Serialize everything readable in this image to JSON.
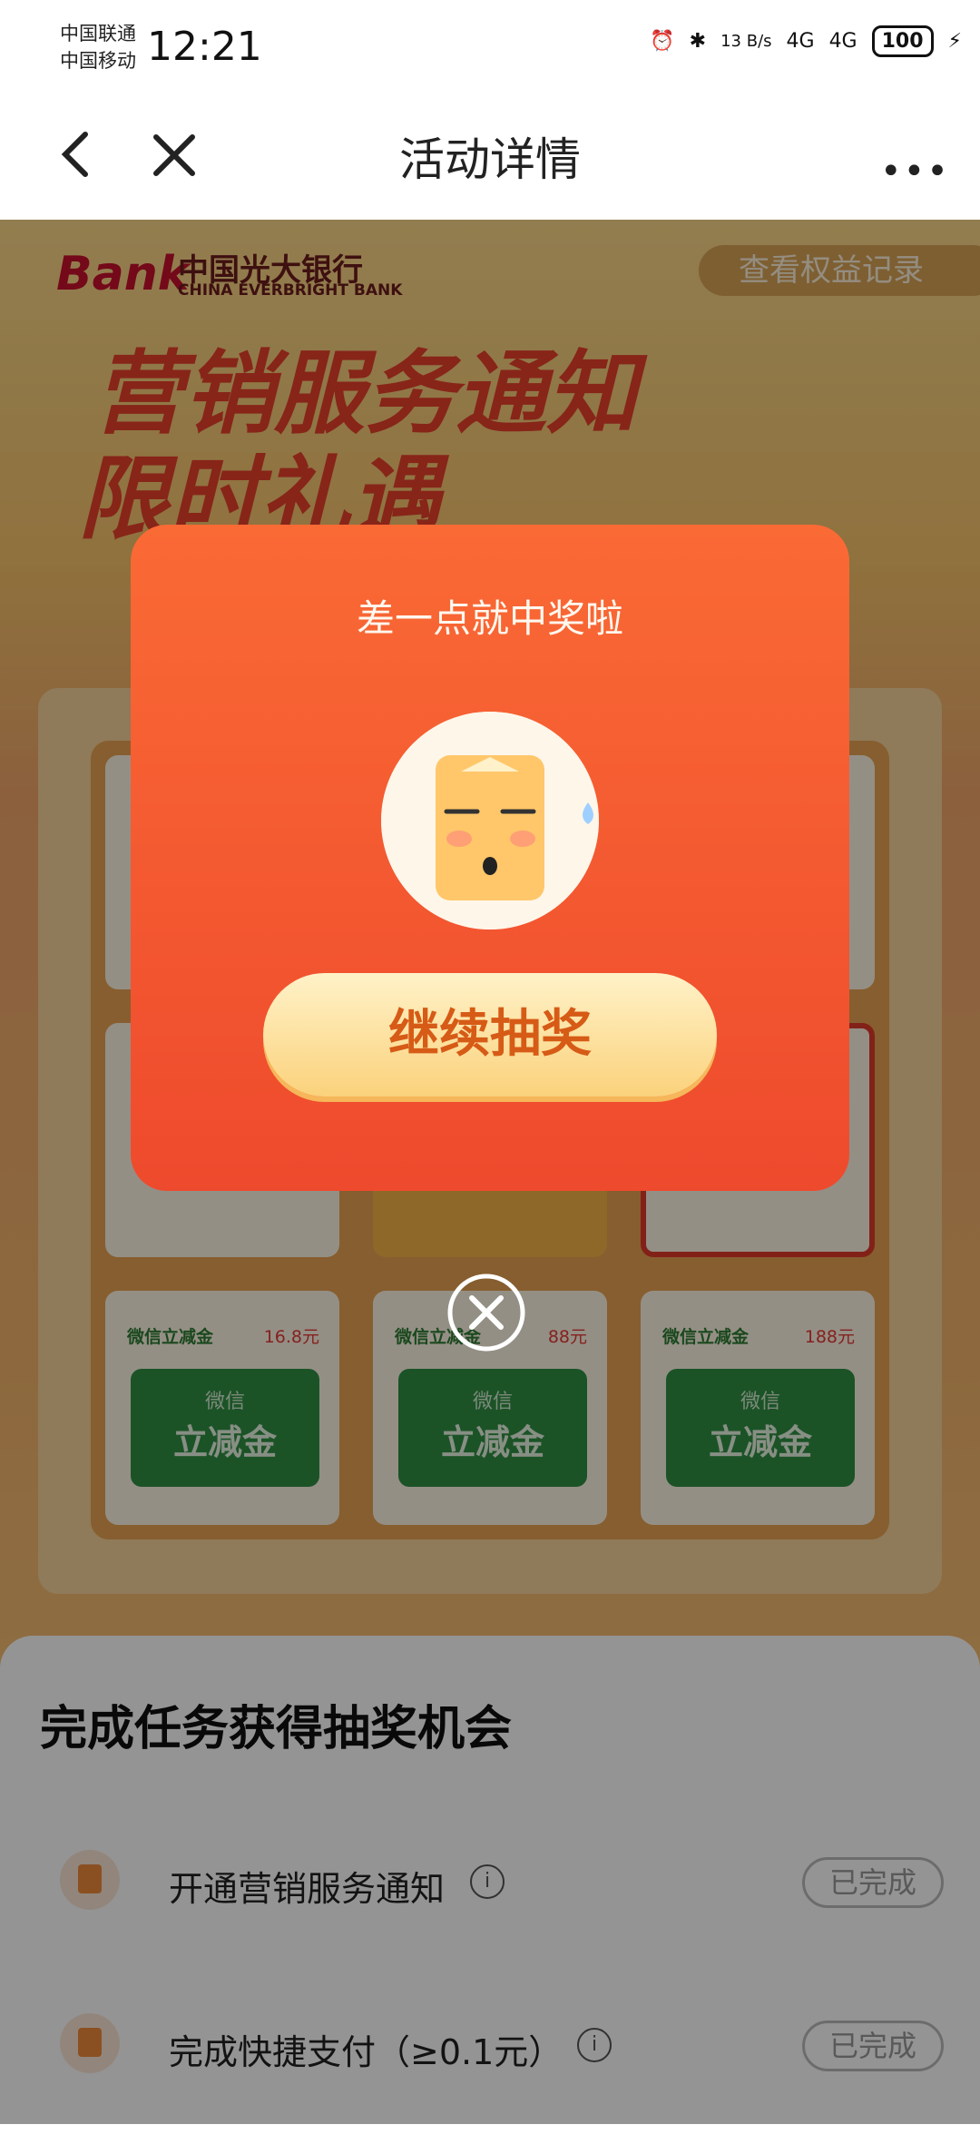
{
  "status_bar": {
    "carrier1": "中国联通",
    "carrier2": "中国移动",
    "time": "12:21",
    "net_speed": "13 B/s",
    "signal1": "4G",
    "signal2": "4G",
    "battery": "100"
  },
  "nav": {
    "title": "活动详情",
    "back_icon": "chevron-left-icon",
    "close_icon": "close-icon",
    "more_icon": "more-horizontal-icon"
  },
  "banner": {
    "logo_mark": "Bank",
    "logo_cn": "中国光大银行",
    "logo_en": "CHINA EVERBRIGHT BANK",
    "records_link": "查看权益记录",
    "headline1": "营销服务通知",
    "headline2": "限时礼遇"
  },
  "grid": {
    "prizes": [
      {
        "label": "微信立减金",
        "amount": "16.8元",
        "card_l1": "微信",
        "card_l2": "立减金"
      },
      {
        "label": "微信立减金",
        "amount": "88元",
        "card_l1": "微信",
        "card_l2": "立减金"
      },
      {
        "label": "微信立减金",
        "amount": "188元",
        "card_l1": "微信",
        "card_l2": "立减金"
      }
    ]
  },
  "tasks": {
    "title": "完成任务获得抽奖机会",
    "items": [
      {
        "label": "开通营销服务通知",
        "status": "已完成"
      },
      {
        "label": "完成快捷支付（≥0.1元）",
        "status": "已完成"
      }
    ]
  },
  "modal": {
    "title": "差一点就中奖啦",
    "button": "继续抽奖",
    "face_icon": "sad-face-icon",
    "close_icon": "circle-close-icon"
  },
  "colors": {
    "modal_top": "#fa6a35",
    "modal_bottom": "#ee4a2d",
    "brand_red": "#e8402b"
  }
}
